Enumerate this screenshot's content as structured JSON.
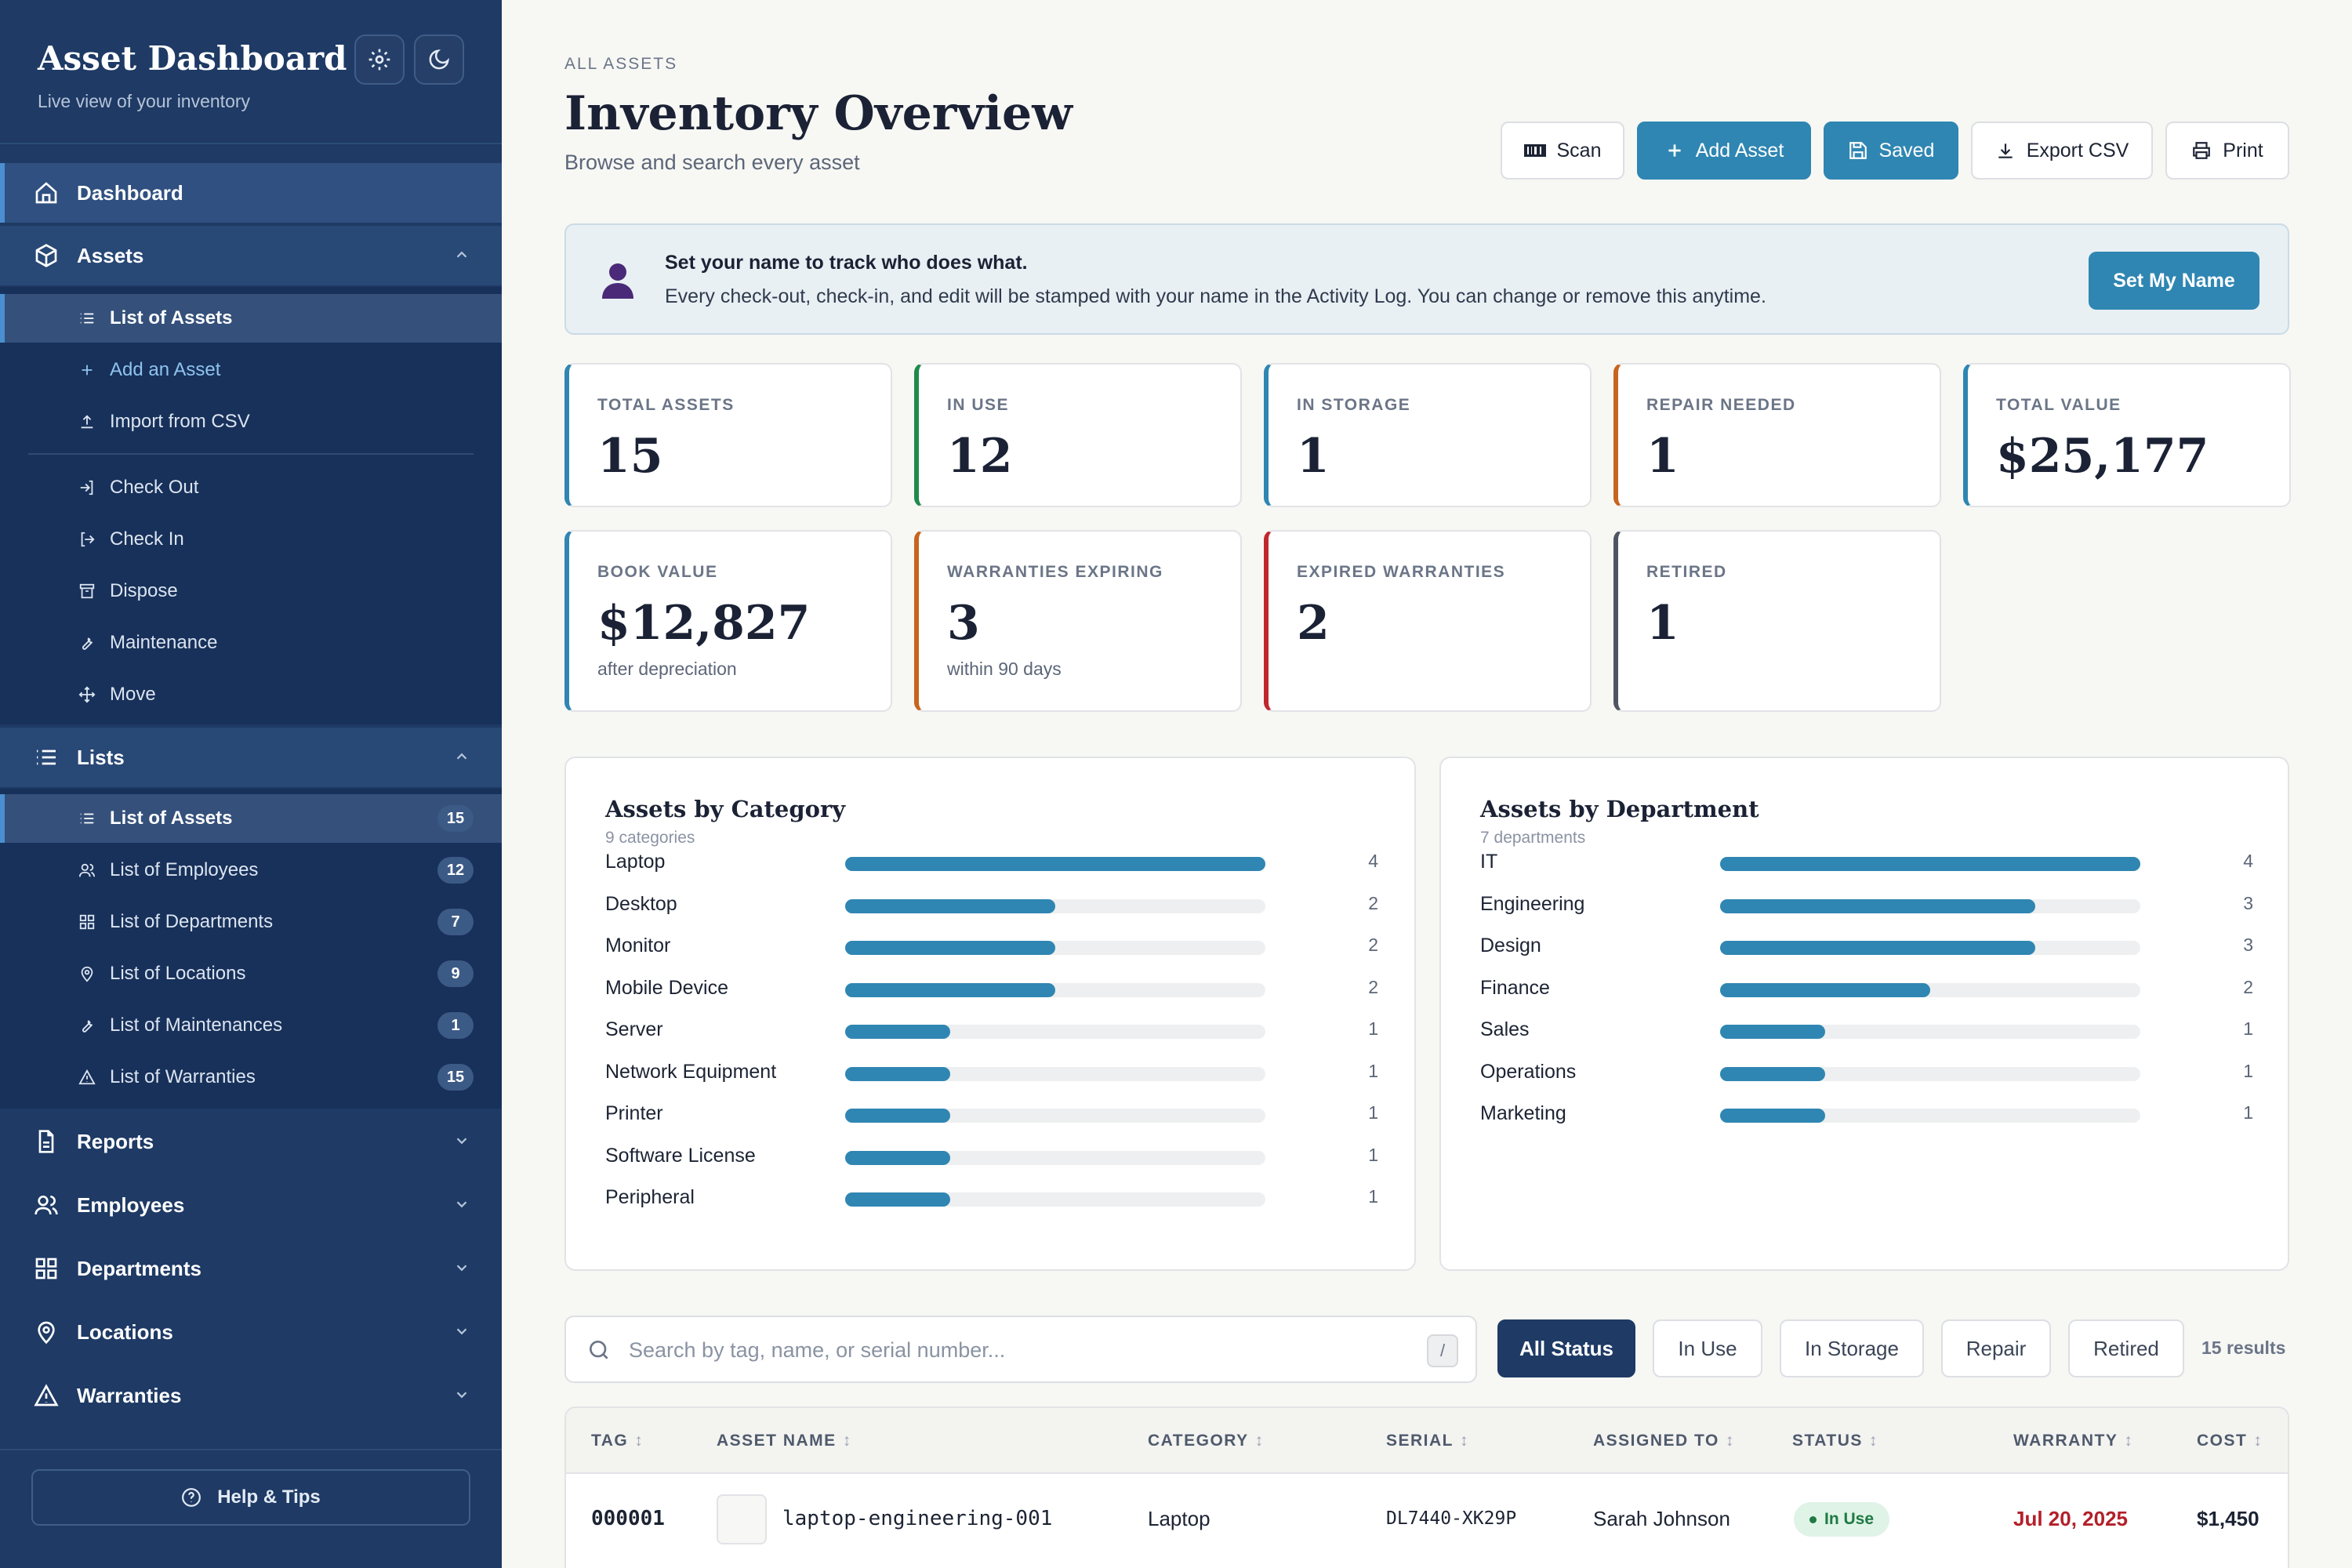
{
  "sidebar": {
    "title": "Asset Dashboard",
    "subtitle": "Live view of your inventory",
    "nav": {
      "dashboard": "Dashboard",
      "assets": "Assets",
      "assets_sub": [
        "List of Assets",
        "Add an Asset",
        "Import from CSV"
      ],
      "actions": [
        "Check Out",
        "Check In",
        "Dispose",
        "Maintenance",
        "Move"
      ],
      "lists": "Lists",
      "lists_sub": [
        {
          "label": "List of Assets",
          "count": "15"
        },
        {
          "label": "List of Employees",
          "count": "12"
        },
        {
          "label": "List of Departments",
          "count": "7"
        },
        {
          "label": "List of Locations",
          "count": "9"
        },
        {
          "label": "List of Maintenances",
          "count": "1"
        },
        {
          "label": "List of Warranties",
          "count": "15"
        }
      ],
      "reports": "Reports",
      "employees": "Employees",
      "departments": "Departments",
      "locations": "Locations",
      "warranties": "Warranties"
    },
    "help": "Help & Tips"
  },
  "header": {
    "breadcrumb": "ALL ASSETS",
    "title": "Inventory Overview",
    "subtitle": "Browse and search every asset",
    "buttons": {
      "scan": "Scan",
      "add": "Add Asset",
      "saved": "Saved",
      "export": "Export CSV",
      "print": "Print"
    }
  },
  "banner": {
    "title": "Set your name to track who does what.",
    "text": "Every check-out, check-in, and edit will be stamped with your name in the Activity Log. You can change or remove this anytime.",
    "button": "Set My Name"
  },
  "stats": [
    {
      "label": "TOTAL ASSETS",
      "value": "15",
      "note": ""
    },
    {
      "label": "IN USE",
      "value": "12",
      "note": ""
    },
    {
      "label": "IN STORAGE",
      "value": "1",
      "note": ""
    },
    {
      "label": "REPAIR NEEDED",
      "value": "1",
      "note": ""
    },
    {
      "label": "TOTAL VALUE",
      "value": "$25,177",
      "note": ""
    },
    {
      "label": "BOOK VALUE",
      "value": "$12,827",
      "note": "after depreciation"
    },
    {
      "label": "WARRANTIES EXPIRING",
      "value": "3",
      "note": "within 90 days"
    },
    {
      "label": "EXPIRED WARRANTIES",
      "value": "2",
      "note": ""
    },
    {
      "label": "RETIRED",
      "value": "1",
      "note": ""
    }
  ],
  "colors": {
    "accent": "#2f86b2",
    "sidebar": "#1e3a65",
    "stat_blue": "#2f86b2",
    "stat_green": "#1f8a4c",
    "stat_orange": "#c8641e",
    "stat_red": "#c0272d",
    "stat_gray": "#4f5560"
  },
  "chart_data": [
    {
      "type": "bar",
      "title": "Assets by Category",
      "subtitle": "9 categories",
      "categories": [
        "Laptop",
        "Desktop",
        "Monitor",
        "Mobile Device",
        "Server",
        "Network Equipment",
        "Printer",
        "Software License",
        "Peripheral"
      ],
      "values": [
        4,
        2,
        2,
        2,
        1,
        1,
        1,
        1,
        1
      ],
      "max": 4
    },
    {
      "type": "bar",
      "title": "Assets by Department",
      "subtitle": "7 departments",
      "categories": [
        "IT",
        "Engineering",
        "Design",
        "Finance",
        "Sales",
        "Operations",
        "Marketing"
      ],
      "values": [
        4,
        3,
        3,
        2,
        1,
        1,
        1
      ],
      "max": 4
    }
  ],
  "search": {
    "placeholder": "Search by tag, name, or serial number...",
    "shortcut": "/",
    "filters": [
      "All Status",
      "In Use",
      "In Storage",
      "Repair",
      "Retired"
    ],
    "results": "15 results"
  },
  "table": {
    "columns": [
      "TAG",
      "ASSET NAME",
      "CATEGORY",
      "SERIAL",
      "ASSIGNED TO",
      "STATUS",
      "WARRANTY",
      "COST"
    ],
    "sort_icon": "↕",
    "rows": [
      {
        "tag": "000001",
        "name": "laptop-engineering-001",
        "category": "Laptop",
        "serial": "DL7440-XK29P",
        "assigned": "Sarah Johnson",
        "status": "In Use",
        "warranty": "Jul 20, 2025",
        "cost": "$1,450"
      }
    ]
  }
}
